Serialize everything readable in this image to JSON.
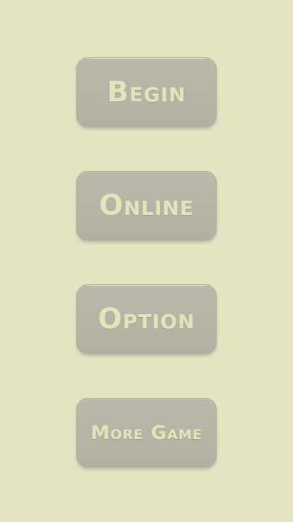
{
  "menu": {
    "begin_label": "Begin",
    "online_label": "Online",
    "option_label": "Option",
    "more_label": "More Game"
  },
  "colors": {
    "background": "#e6e3c3",
    "button": "#b5b4a6",
    "button_text": "#e4e3ba"
  }
}
